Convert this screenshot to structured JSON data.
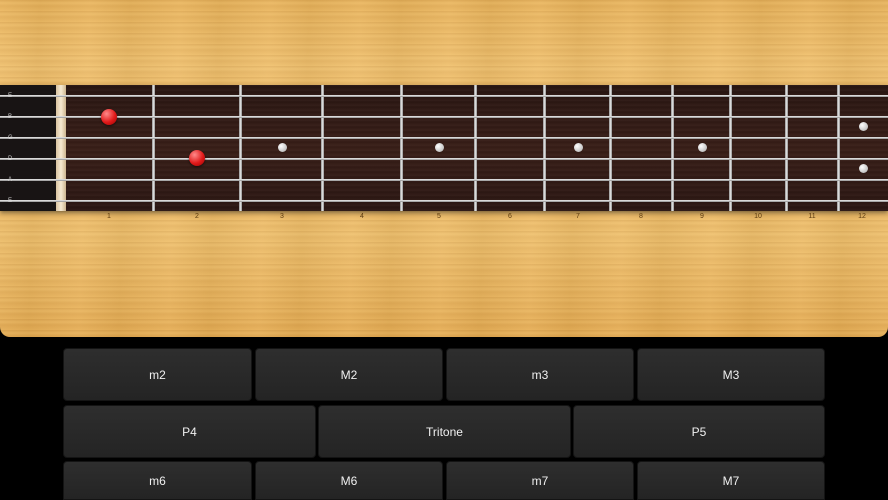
{
  "strings": [
    "E",
    "B",
    "G",
    "D",
    "A",
    "E"
  ],
  "fret_numbers": [
    "1",
    "2",
    "3",
    "4",
    "5",
    "6",
    "7",
    "8",
    "9",
    "10",
    "11",
    "12"
  ],
  "selected_notes": [
    {
      "string": "B",
      "fret": 1
    },
    {
      "string": "D",
      "fret": 2
    }
  ],
  "note_color": "#e01a1a",
  "intervals": {
    "row1": [
      "m2",
      "M2",
      "m3",
      "M3"
    ],
    "row2": [
      "P4",
      "Tritone",
      "P5"
    ],
    "row3": [
      "m6",
      "M6",
      "m7",
      "M7"
    ]
  }
}
